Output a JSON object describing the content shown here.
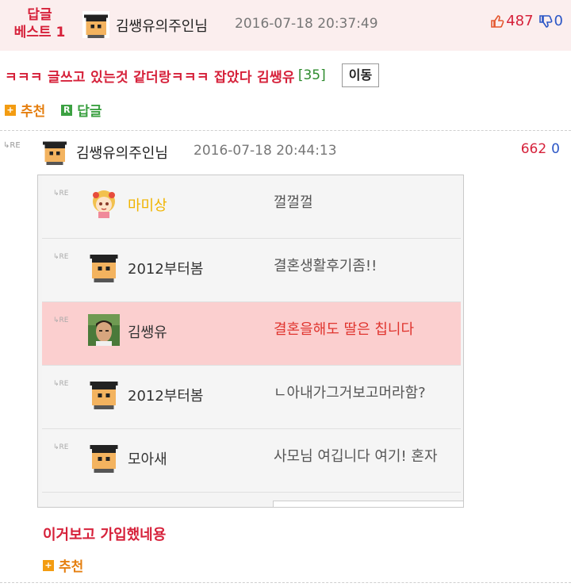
{
  "post": {
    "badge_line1": "답글",
    "badge_line2": "베스트 1",
    "author": "김쌩유의주인님",
    "date": "2016-07-18 20:37:49",
    "up_votes": "487",
    "down_votes": "0",
    "title": "ㅋㅋㅋ 글쓰고 있는것 같더랑ㅋㅋㅋ 잡았다 김쌩유",
    "comment_count": "[35]",
    "move_label": "이동",
    "recommend_label": "추천",
    "reply_label": "답글",
    "reply_icon_letter": "R",
    "plus_icon": "+"
  },
  "comment": {
    "re_mark": "↳RE",
    "author": "김쌩유의주인님",
    "date": "2016-07-18 20:44:13",
    "up_votes": "662",
    "down_votes": "0",
    "text": "이거보고 가입했네용",
    "recommend_label": "추천"
  },
  "embedded_comments": [
    {
      "re": "↳RE",
      "name": "마미상",
      "message": "껄껄껄",
      "avatar": "cartoon-girl-avatar"
    },
    {
      "re": "↳RE",
      "name": "2012부터봄",
      "message": "결혼생활후기좀!!",
      "avatar": "pixel-default-avatar"
    },
    {
      "re": "↳RE",
      "name": "김쌩유",
      "message": "결혼을해도 딸은 칩니다",
      "avatar": "photo-avatar"
    },
    {
      "re": "↳RE",
      "name": "2012부터봄",
      "message": "ㄴ아내가그거보고머라함?",
      "avatar": "pixel-default-avatar"
    },
    {
      "re": "↳RE",
      "name": "모아새",
      "message": "사모님 여깁니다 여기! 혼자",
      "avatar": "pixel-default-avatar"
    }
  ],
  "colors": {
    "accent_red": "#d6213a",
    "down_blue": "#2b56c6",
    "recommend_orange": "#f39c12",
    "reply_green": "#3ca142",
    "highlight_pink": "#fbcfcf",
    "header_bg": "#fbeeee"
  }
}
